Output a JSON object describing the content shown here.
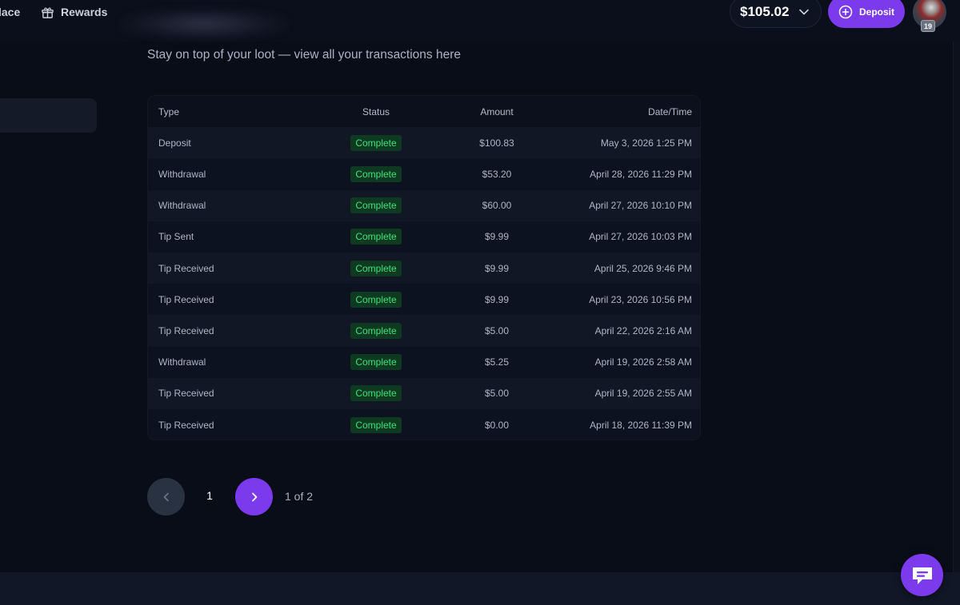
{
  "nav": {
    "items": [
      {
        "label": "lace",
        "icon": "marketplace-icon"
      },
      {
        "label": "Rewards",
        "icon": "gift-icon"
      }
    ],
    "balance": "$105.02",
    "deposit_label": "Deposit",
    "user_level": "19"
  },
  "main": {
    "subtitle": "Stay on top of your loot — view all your transactions here",
    "table": {
      "headers": {
        "type": "Type",
        "status": "Status",
        "amount": "Amount",
        "date": "Date/Time"
      },
      "rows": [
        {
          "type": "Deposit",
          "status": "Complete",
          "amount": "$100.83",
          "date": "May 3, 2026 1:25 PM"
        },
        {
          "type": "Withdrawal",
          "status": "Complete",
          "amount": "$53.20",
          "date": "April 28, 2026 11:29 PM"
        },
        {
          "type": "Withdrawal",
          "status": "Complete",
          "amount": "$60.00",
          "date": "April 27, 2026 10:10 PM"
        },
        {
          "type": "Tip Sent",
          "status": "Complete",
          "amount": "$9.99",
          "date": "April 27, 2026 10:03 PM"
        },
        {
          "type": "Tip Received",
          "status": "Complete",
          "amount": "$9.99",
          "date": "April 25, 2026 9:46 PM"
        },
        {
          "type": "Tip Received",
          "status": "Complete",
          "amount": "$9.99",
          "date": "April 23, 2026 10:56 PM"
        },
        {
          "type": "Tip Received",
          "status": "Complete",
          "amount": "$5.00",
          "date": "April 22, 2026 2:16 AM"
        },
        {
          "type": "Withdrawal",
          "status": "Complete",
          "amount": "$5.25",
          "date": "April 19, 2026 2:58 AM"
        },
        {
          "type": "Tip Received",
          "status": "Complete",
          "amount": "$5.00",
          "date": "April 19, 2026 2:55 AM"
        },
        {
          "type": "Tip Received",
          "status": "Complete",
          "amount": "$0.00",
          "date": "April 18, 2026 11:39 PM"
        }
      ]
    },
    "pagination": {
      "current_page": "1",
      "info": "1 of 2"
    }
  },
  "colors": {
    "accent": "#7c3aed",
    "background": "#090d18",
    "status_complete_text": "#3ee07a",
    "status_complete_bg": "#0f3a22"
  }
}
